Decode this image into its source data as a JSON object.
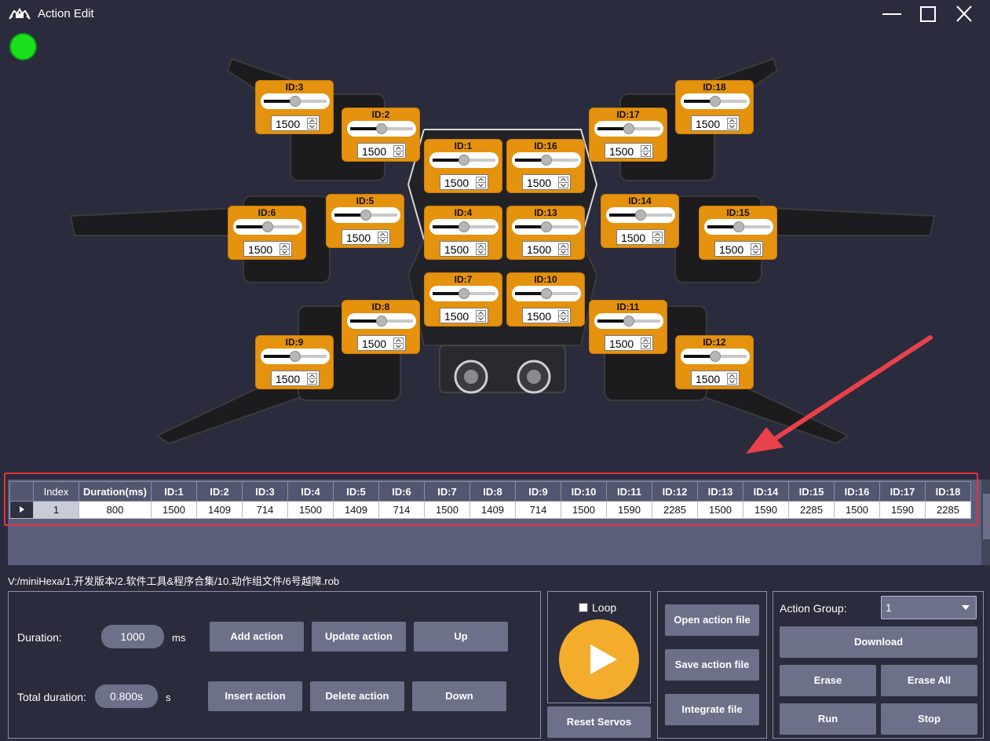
{
  "window": {
    "title": "Action Edit"
  },
  "servos": [
    {
      "id": 3,
      "label": "ID:3",
      "value": "1500",
      "slider_level": 0.5
    },
    {
      "id": 2,
      "label": "ID:2",
      "value": "1500",
      "slider_level": 0.5
    },
    {
      "id": 1,
      "label": "ID:1",
      "value": "1500",
      "slider_level": 0.5
    },
    {
      "id": 16,
      "label": "ID:16",
      "value": "1500",
      "slider_level": 0.5
    },
    {
      "id": 17,
      "label": "ID:17",
      "value": "1500",
      "slider_level": 0.5
    },
    {
      "id": 18,
      "label": "ID:18",
      "value": "1500",
      "slider_level": 0.5
    },
    {
      "id": 6,
      "label": "ID:6",
      "value": "1500",
      "slider_level": 0.5
    },
    {
      "id": 5,
      "label": "ID:5",
      "value": "1500",
      "slider_level": 0.5
    },
    {
      "id": 4,
      "label": "ID:4",
      "value": "1500",
      "slider_level": 0.5
    },
    {
      "id": 13,
      "label": "ID:13",
      "value": "1500",
      "slider_level": 0.5
    },
    {
      "id": 14,
      "label": "ID:14",
      "value": "1500",
      "slider_level": 0.5
    },
    {
      "id": 15,
      "label": "ID:15",
      "value": "1500",
      "slider_level": 0.5
    },
    {
      "id": 7,
      "label": "ID:7",
      "value": "1500",
      "slider_level": 0.5
    },
    {
      "id": 10,
      "label": "ID:10",
      "value": "1500",
      "slider_level": 0.5
    },
    {
      "id": 8,
      "label": "ID:8",
      "value": "1500",
      "slider_level": 0.5
    },
    {
      "id": 11,
      "label": "ID:11",
      "value": "1500",
      "slider_level": 0.5
    },
    {
      "id": 9,
      "label": "ID:9",
      "value": "1500",
      "slider_level": 0.5
    },
    {
      "id": 12,
      "label": "ID:12",
      "value": "1500",
      "slider_level": 0.5
    }
  ],
  "table": {
    "headers": [
      "",
      "Index",
      "Duration(ms)",
      "ID:1",
      "ID:2",
      "ID:3",
      "ID:4",
      "ID:5",
      "ID:6",
      "ID:7",
      "ID:8",
      "ID:9",
      "ID:10",
      "ID:11",
      "ID:12",
      "ID:13",
      "ID:14",
      "ID:15",
      "ID:16",
      "ID:17",
      "ID:18"
    ],
    "rows": [
      [
        "",
        "1",
        "800",
        "1500",
        "1409",
        "714",
        "1500",
        "1409",
        "714",
        "1500",
        "1409",
        "714",
        "1500",
        "1590",
        "2285",
        "1500",
        "1590",
        "2285",
        "1500",
        "1590",
        "2285"
      ]
    ]
  },
  "file_path": "V:/miniHexa/1.开发版本/2.软件工具&程序合集/10.动作组文件/6号越障.rob",
  "edit": {
    "duration_label": "Duration:",
    "duration_value": "1000",
    "duration_unit": "ms",
    "total_label": "Total duration:",
    "total_value": "0.800s",
    "total_unit": "s",
    "add_action": "Add action",
    "update_action": "Update action",
    "up": "Up",
    "insert_action": "Insert action",
    "delete_action": "Delete action",
    "down": "Down"
  },
  "run": {
    "loop_label": "Loop",
    "loop_checked": false,
    "reset_servos": "Reset Servos"
  },
  "file": {
    "open": "Open action file",
    "save": "Save action file",
    "integrate": "Integrate file"
  },
  "group": {
    "label": "Action Group:",
    "selected": "1",
    "download": "Download",
    "erase": "Erase",
    "erase_all": "Erase All",
    "run": "Run",
    "stop": "Stop"
  },
  "colors": {
    "background": "#2a2b3c",
    "servo_panel": "#e5920e",
    "button": "#6d7089",
    "status_led": "#19e01c",
    "play_button": "#f4ac2c",
    "highlight": "#e0343f"
  },
  "icons": {
    "status": "status-led-icon",
    "play": "play-icon",
    "minimize": "minimize-icon",
    "maximize": "maximize-icon",
    "close": "close-icon"
  }
}
